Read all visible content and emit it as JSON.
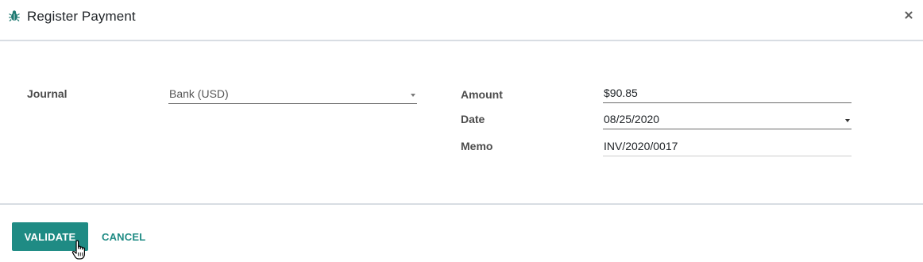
{
  "dialog": {
    "title": "Register Payment",
    "icons": {
      "title_icon": "bug-icon",
      "close": "close-icon"
    }
  },
  "form": {
    "journal": {
      "label": "Journal",
      "value": "Bank (USD)"
    },
    "amount": {
      "label": "Amount",
      "value": "$90.85"
    },
    "date": {
      "label": "Date",
      "value": "08/25/2020"
    },
    "memo": {
      "label": "Memo",
      "value": "INV/2020/0017"
    }
  },
  "footer": {
    "validate_label": "VALIDATE",
    "cancel_label": "CANCEL"
  },
  "colors": {
    "accent": "#1f8b84",
    "divider": "#d8dde3",
    "label": "#4c4c4c"
  }
}
